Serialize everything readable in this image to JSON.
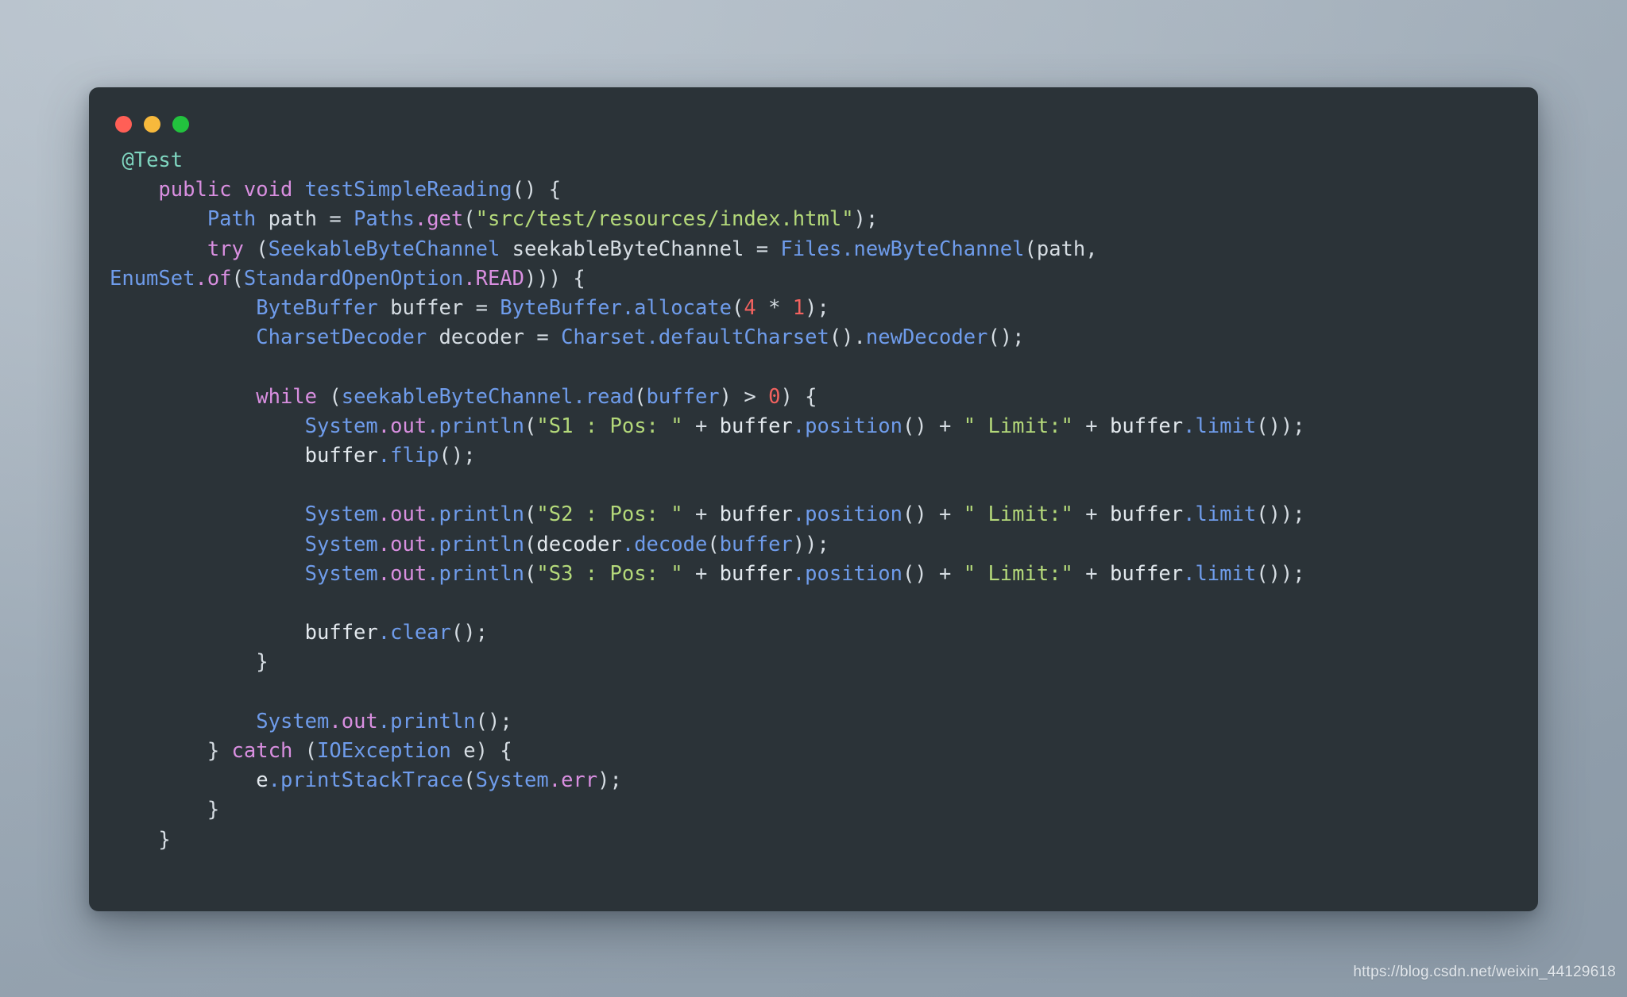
{
  "window": {
    "traffic_lights": [
      {
        "name": "close-button",
        "color": "#ff5f56",
        "label": ""
      },
      {
        "name": "minimize-button",
        "color": "#f7b93c",
        "label": ""
      },
      {
        "name": "maximize-button",
        "color": "#22c23e",
        "label": ""
      }
    ],
    "background_color": "#2b3338"
  },
  "theme": {
    "background": "#2b3338",
    "page_background": "#a9b4be",
    "foreground": "#d6dde3",
    "annotation": "#7fd6c0",
    "keyword": "#d98fe0",
    "type": "#6f9ceb",
    "function": "#6f9ceb",
    "member": "#d98fe0",
    "string": "#b4d97a",
    "number": "#f2625f"
  },
  "code": {
    "language": "java",
    "plain_text": "@Test\n    public void testSimpleReading() {\n        Path path = Paths.get(\"src/test/resources/index.html\");\n        try (SeekableByteChannel seekableByteChannel = Files.newByteChannel(path, EnumSet.of(StandardOpenOption.READ))) {\n            ByteBuffer buffer = ByteBuffer.allocate(4 * 1);\n            CharsetDecoder decoder = Charset.defaultCharset().newDecoder();\n\n            while (seekableByteChannel.read(buffer) > 0) {\n                System.out.println(\"S1 : Pos: \" + buffer.position() + \" Limit:\" + buffer.limit());\n                buffer.flip();\n\n                System.out.println(\"S2 : Pos: \" + buffer.position() + \" Limit:\" + buffer.limit());\n                System.out.println(decoder.decode(buffer));\n                System.out.println(\"S3 : Pos: \" + buffer.position() + \" Limit:\" + buffer.limit());\n\n                buffer.clear();\n            }\n\n            System.out.println();\n        } catch (IOException e) {\n            e.printStackTrace(System.err);\n        }\n    }",
    "lines": [
      {
        "id": "l1",
        "tokens": [
          {
            "t": " ",
            "c": "t-plain"
          },
          {
            "t": "@Test",
            "c": "t-anno"
          }
        ]
      },
      {
        "id": "l2",
        "tokens": [
          {
            "t": "    ",
            "c": "t-plain"
          },
          {
            "t": "public void",
            "c": "t-kw"
          },
          {
            "t": " ",
            "c": "t-plain"
          },
          {
            "t": "testSimpleReading",
            "c": "t-fn"
          },
          {
            "t": "() {",
            "c": "t-punct"
          }
        ]
      },
      {
        "id": "l3",
        "tokens": [
          {
            "t": "        ",
            "c": "t-plain"
          },
          {
            "t": "Path",
            "c": "t-type"
          },
          {
            "t": " path = ",
            "c": "t-plain"
          },
          {
            "t": "Paths",
            "c": "t-type"
          },
          {
            "t": ".get",
            "c": "t-member"
          },
          {
            "t": "(",
            "c": "t-punct"
          },
          {
            "t": "\"src/test/resources/index.html\"",
            "c": "t-str"
          },
          {
            "t": ");",
            "c": "t-punct"
          }
        ]
      },
      {
        "id": "l4",
        "tokens": [
          {
            "t": "        ",
            "c": "t-plain"
          },
          {
            "t": "try",
            "c": "t-kw"
          },
          {
            "t": " (",
            "c": "t-punct"
          },
          {
            "t": "SeekableByteChannel",
            "c": "t-type"
          },
          {
            "t": " seekableByteChannel = ",
            "c": "t-plain"
          },
          {
            "t": "Files",
            "c": "t-type"
          },
          {
            "t": ".newByteChannel",
            "c": "t-fn"
          },
          {
            "t": "(path,",
            "c": "t-punct"
          }
        ]
      },
      {
        "id": "l5",
        "tokens": [
          {
            "t": "EnumSet",
            "c": "t-type"
          },
          {
            "t": ".of",
            "c": "t-member"
          },
          {
            "t": "(",
            "c": "t-punct"
          },
          {
            "t": "StandardOpenOption",
            "c": "t-type"
          },
          {
            "t": ".READ",
            "c": "t-member"
          },
          {
            "t": "))) {",
            "c": "t-punct"
          }
        ]
      },
      {
        "id": "l6",
        "tokens": [
          {
            "t": "            ",
            "c": "t-plain"
          },
          {
            "t": "ByteBuffer",
            "c": "t-type"
          },
          {
            "t": " buffer = ",
            "c": "t-plain"
          },
          {
            "t": "ByteBuffer",
            "c": "t-type"
          },
          {
            "t": ".allocate",
            "c": "t-fn"
          },
          {
            "t": "(",
            "c": "t-punct"
          },
          {
            "t": "4",
            "c": "t-num"
          },
          {
            "t": " * ",
            "c": "t-op"
          },
          {
            "t": "1",
            "c": "t-num"
          },
          {
            "t": ");",
            "c": "t-punct"
          }
        ]
      },
      {
        "id": "l7",
        "tokens": [
          {
            "t": "            ",
            "c": "t-plain"
          },
          {
            "t": "CharsetDecoder",
            "c": "t-type"
          },
          {
            "t": " decoder = ",
            "c": "t-plain"
          },
          {
            "t": "Charset",
            "c": "t-type"
          },
          {
            "t": ".defaultCharset",
            "c": "t-fn"
          },
          {
            "t": "().",
            "c": "t-punct"
          },
          {
            "t": "newDecoder",
            "c": "t-fn"
          },
          {
            "t": "();",
            "c": "t-punct"
          }
        ]
      },
      {
        "id": "l8",
        "tokens": []
      },
      {
        "id": "l9",
        "tokens": [
          {
            "t": "            ",
            "c": "t-plain"
          },
          {
            "t": "while",
            "c": "t-kw"
          },
          {
            "t": " (",
            "c": "t-punct"
          },
          {
            "t": "seekableByteChannel",
            "c": "t-type"
          },
          {
            "t": ".read",
            "c": "t-fn"
          },
          {
            "t": "(",
            "c": "t-punct"
          },
          {
            "t": "buffer",
            "c": "t-type"
          },
          {
            "t": ") > ",
            "c": "t-punct"
          },
          {
            "t": "0",
            "c": "t-num"
          },
          {
            "t": ") {",
            "c": "t-punct"
          }
        ]
      },
      {
        "id": "l10",
        "tokens": [
          {
            "t": "                ",
            "c": "t-plain"
          },
          {
            "t": "System",
            "c": "t-type"
          },
          {
            "t": ".out",
            "c": "t-member"
          },
          {
            "t": ".println",
            "c": "t-fn"
          },
          {
            "t": "(",
            "c": "t-punct"
          },
          {
            "t": "\"S1 : Pos: \"",
            "c": "t-str"
          },
          {
            "t": " + ",
            "c": "t-op"
          },
          {
            "t": "buffer",
            "c": "t-var"
          },
          {
            "t": ".position",
            "c": "t-fn"
          },
          {
            "t": "() + ",
            "c": "t-punct"
          },
          {
            "t": "\" Limit:\"",
            "c": "t-str"
          },
          {
            "t": " + ",
            "c": "t-op"
          },
          {
            "t": "buffer",
            "c": "t-var"
          },
          {
            "t": ".limit",
            "c": "t-fn"
          },
          {
            "t": "());",
            "c": "t-punct"
          }
        ]
      },
      {
        "id": "l11",
        "tokens": [
          {
            "t": "                ",
            "c": "t-plain"
          },
          {
            "t": "buffer",
            "c": "t-var"
          },
          {
            "t": ".flip",
            "c": "t-fn"
          },
          {
            "t": "();",
            "c": "t-punct"
          }
        ]
      },
      {
        "id": "l12",
        "tokens": []
      },
      {
        "id": "l13",
        "tokens": [
          {
            "t": "                ",
            "c": "t-plain"
          },
          {
            "t": "System",
            "c": "t-type"
          },
          {
            "t": ".out",
            "c": "t-member"
          },
          {
            "t": ".println",
            "c": "t-fn"
          },
          {
            "t": "(",
            "c": "t-punct"
          },
          {
            "t": "\"S2 : Pos: \"",
            "c": "t-str"
          },
          {
            "t": " + ",
            "c": "t-op"
          },
          {
            "t": "buffer",
            "c": "t-var"
          },
          {
            "t": ".position",
            "c": "t-fn"
          },
          {
            "t": "() + ",
            "c": "t-punct"
          },
          {
            "t": "\" Limit:\"",
            "c": "t-str"
          },
          {
            "t": " + ",
            "c": "t-op"
          },
          {
            "t": "buffer",
            "c": "t-var"
          },
          {
            "t": ".limit",
            "c": "t-fn"
          },
          {
            "t": "());",
            "c": "t-punct"
          }
        ]
      },
      {
        "id": "l14",
        "tokens": [
          {
            "t": "                ",
            "c": "t-plain"
          },
          {
            "t": "System",
            "c": "t-type"
          },
          {
            "t": ".out",
            "c": "t-member"
          },
          {
            "t": ".println",
            "c": "t-fn"
          },
          {
            "t": "(",
            "c": "t-punct"
          },
          {
            "t": "decoder",
            "c": "t-var"
          },
          {
            "t": ".decode",
            "c": "t-fn"
          },
          {
            "t": "(",
            "c": "t-punct"
          },
          {
            "t": "buffer",
            "c": "t-type"
          },
          {
            "t": "));",
            "c": "t-punct"
          }
        ]
      },
      {
        "id": "l15",
        "tokens": [
          {
            "t": "                ",
            "c": "t-plain"
          },
          {
            "t": "System",
            "c": "t-type"
          },
          {
            "t": ".out",
            "c": "t-member"
          },
          {
            "t": ".println",
            "c": "t-fn"
          },
          {
            "t": "(",
            "c": "t-punct"
          },
          {
            "t": "\"S3 : Pos: \"",
            "c": "t-str"
          },
          {
            "t": " + ",
            "c": "t-op"
          },
          {
            "t": "buffer",
            "c": "t-var"
          },
          {
            "t": ".position",
            "c": "t-fn"
          },
          {
            "t": "() + ",
            "c": "t-punct"
          },
          {
            "t": "\" Limit:\"",
            "c": "t-str"
          },
          {
            "t": " + ",
            "c": "t-op"
          },
          {
            "t": "buffer",
            "c": "t-var"
          },
          {
            "t": ".limit",
            "c": "t-fn"
          },
          {
            "t": "());",
            "c": "t-punct"
          }
        ]
      },
      {
        "id": "l16",
        "tokens": []
      },
      {
        "id": "l17",
        "tokens": [
          {
            "t": "                ",
            "c": "t-plain"
          },
          {
            "t": "buffer",
            "c": "t-var"
          },
          {
            "t": ".clear",
            "c": "t-fn"
          },
          {
            "t": "();",
            "c": "t-punct"
          }
        ]
      },
      {
        "id": "l18",
        "tokens": [
          {
            "t": "            }",
            "c": "t-punct"
          }
        ]
      },
      {
        "id": "l19",
        "tokens": []
      },
      {
        "id": "l20",
        "tokens": [
          {
            "t": "            ",
            "c": "t-plain"
          },
          {
            "t": "System",
            "c": "t-type"
          },
          {
            "t": ".out",
            "c": "t-member"
          },
          {
            "t": ".println",
            "c": "t-fn"
          },
          {
            "t": "();",
            "c": "t-punct"
          }
        ]
      },
      {
        "id": "l21",
        "tokens": [
          {
            "t": "        } ",
            "c": "t-punct"
          },
          {
            "t": "catch",
            "c": "t-kw"
          },
          {
            "t": " (",
            "c": "t-punct"
          },
          {
            "t": "IOException",
            "c": "t-type"
          },
          {
            "t": " e",
            "c": "t-plain"
          },
          {
            "t": ") {",
            "c": "t-punct"
          }
        ]
      },
      {
        "id": "l22",
        "tokens": [
          {
            "t": "            ",
            "c": "t-plain"
          },
          {
            "t": "e",
            "c": "t-var"
          },
          {
            "t": ".printStackTrace",
            "c": "t-fn"
          },
          {
            "t": "(",
            "c": "t-punct"
          },
          {
            "t": "System",
            "c": "t-type"
          },
          {
            "t": ".err",
            "c": "t-member"
          },
          {
            "t": ");",
            "c": "t-punct"
          }
        ]
      },
      {
        "id": "l23",
        "tokens": [
          {
            "t": "        }",
            "c": "t-punct"
          }
        ]
      },
      {
        "id": "l24",
        "tokens": [
          {
            "t": "    }",
            "c": "t-punct"
          }
        ]
      }
    ]
  },
  "watermark": {
    "text": "https://blog.csdn.net/weixin_44129618"
  }
}
